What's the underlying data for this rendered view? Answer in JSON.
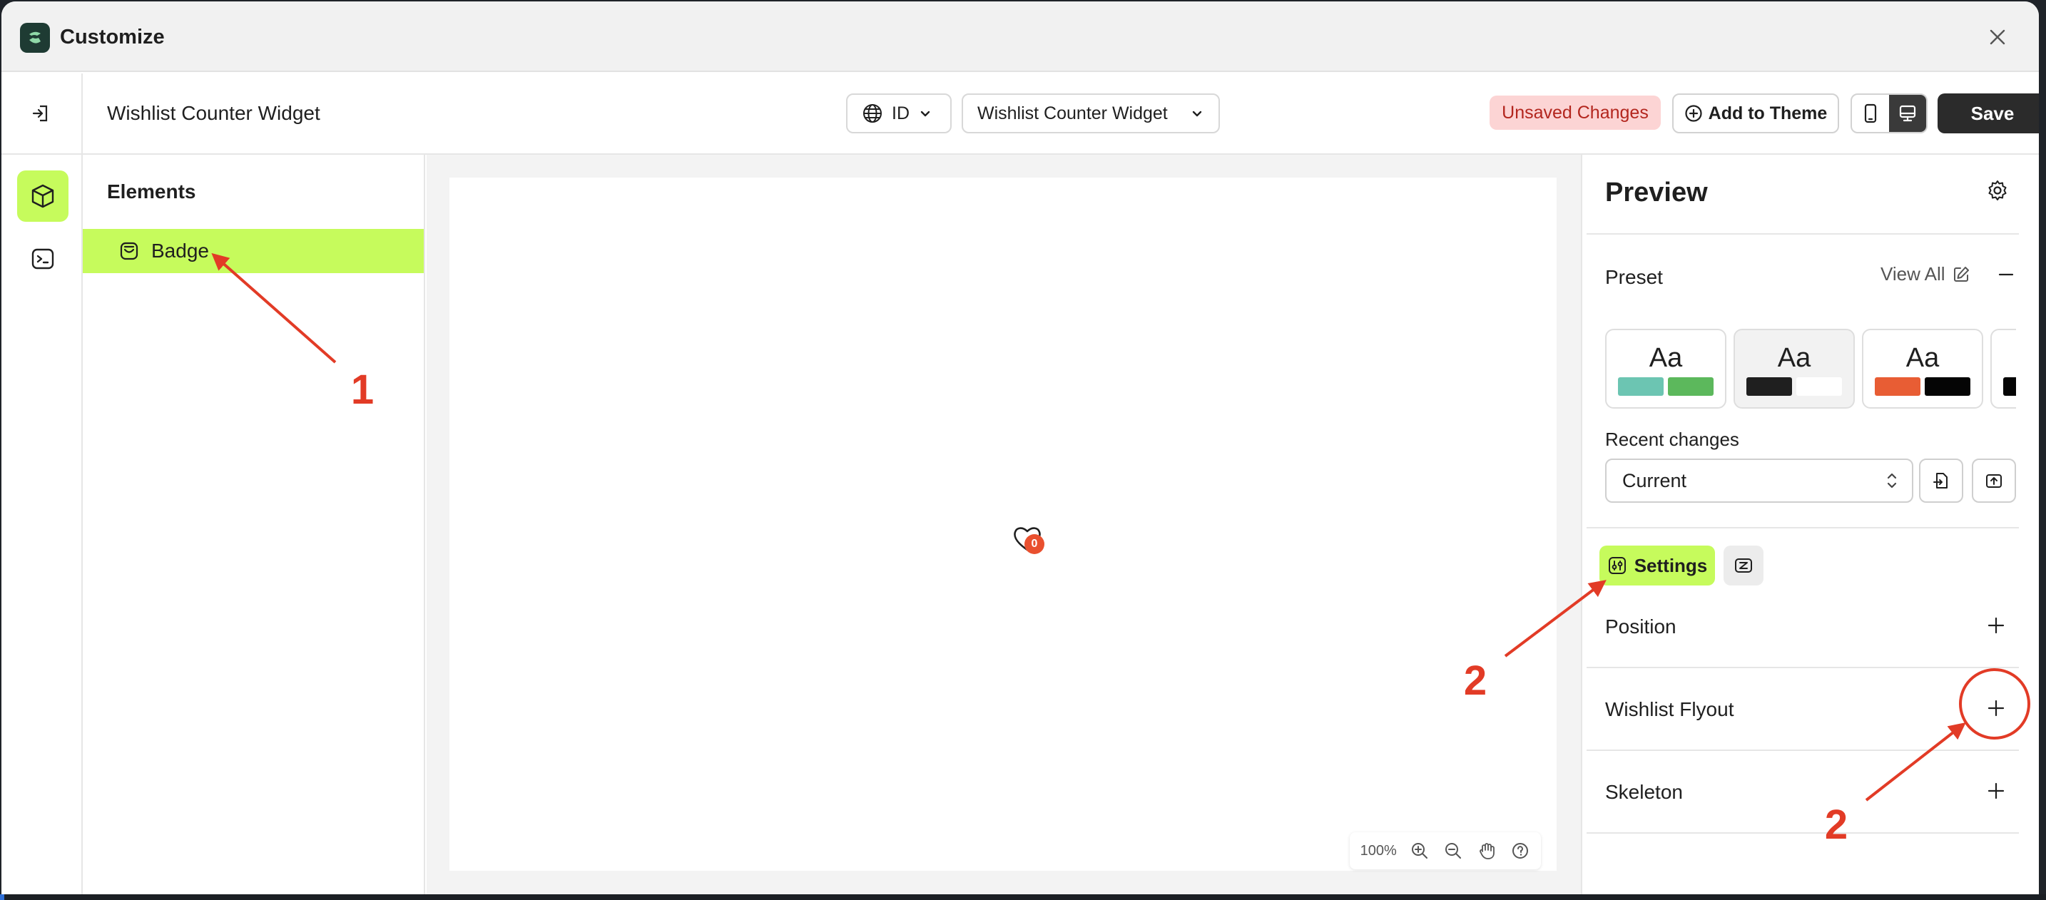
{
  "window": {
    "title": "Customize",
    "close_icon": "close-icon"
  },
  "topbar": {
    "widget_name": "Wishlist Counter Widget",
    "language": "ID",
    "widget_select": "Wishlist Counter Widget",
    "unsaved": "Unsaved Changes",
    "add_to_theme": "Add to Theme",
    "save": "Save"
  },
  "elements": {
    "title": "Elements",
    "items": [
      {
        "label": "Badge"
      }
    ]
  },
  "canvas": {
    "badge_count": "0",
    "zoom": "100%"
  },
  "panel": {
    "title": "Preview",
    "preset_label": "Preset",
    "view_all": "View All",
    "preset_text": "Aa",
    "presets": [
      {
        "colors": [
          "#6cc5b2",
          "#5cb85c"
        ]
      },
      {
        "colors": [
          "#1f1f1f",
          "#ffffff"
        ]
      },
      {
        "colors": [
          "#e85d34",
          "#050505"
        ]
      },
      {
        "colors": [
          "#050505",
          "#050505"
        ]
      }
    ],
    "recent_label": "Recent changes",
    "recent_value": "Current",
    "settings_tab": "Settings",
    "sections": [
      "Position",
      "Wishlist Flyout",
      "Skeleton"
    ]
  },
  "annotations": {
    "labels": [
      "1",
      "2",
      "2"
    ],
    "color": "#e23b26"
  },
  "colors": {
    "accent": "#c6fb5c",
    "badge": "#e9502f",
    "unsaved_bg": "#fcd4d4",
    "unsaved_text": "#b3261e"
  }
}
